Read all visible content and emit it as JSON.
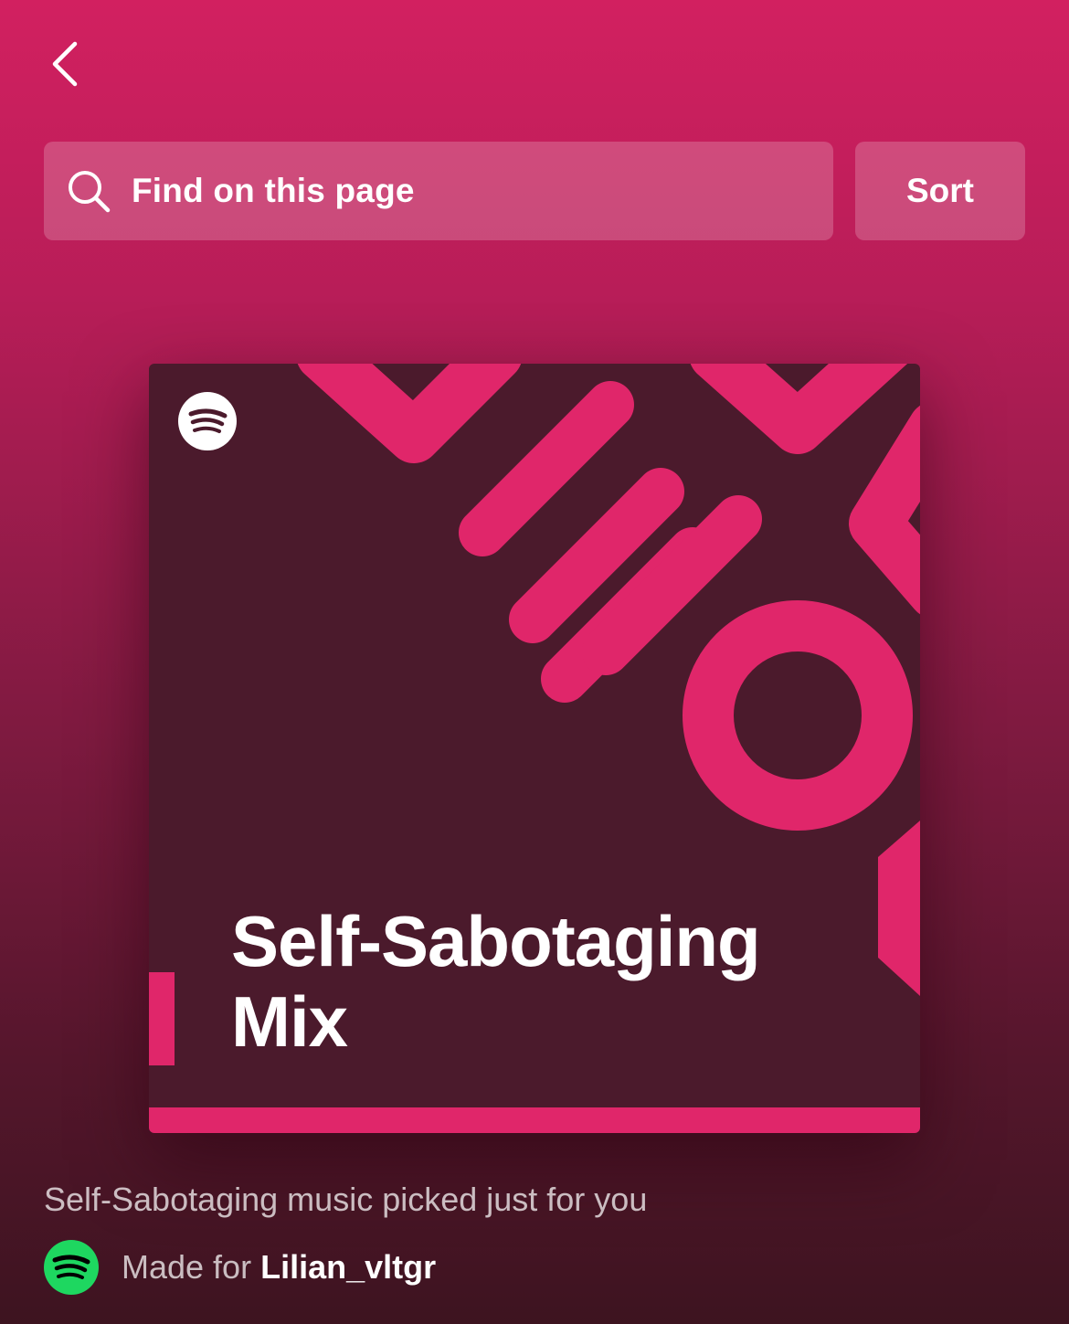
{
  "nav": {
    "back_icon": "chevron-left-icon"
  },
  "search": {
    "icon": "search-icon",
    "placeholder": "Find on this page"
  },
  "sort": {
    "label": "Sort"
  },
  "cover": {
    "title_line1": "Self-Sabotaging",
    "title_line2": "Mix",
    "logo_icon": "spotify-logo-icon",
    "colors": {
      "background": "#4b1a2c",
      "accent": "#e0266a"
    }
  },
  "playlist": {
    "description": "Self-Sabotaging music picked just for you",
    "made_for_label": "Made for",
    "made_for_user": "Lilian_vltgr",
    "made_for_icon": "spotify-logo-icon"
  },
  "theme": {
    "brand_green": "#1ed760",
    "header_pink": "#d22060"
  }
}
